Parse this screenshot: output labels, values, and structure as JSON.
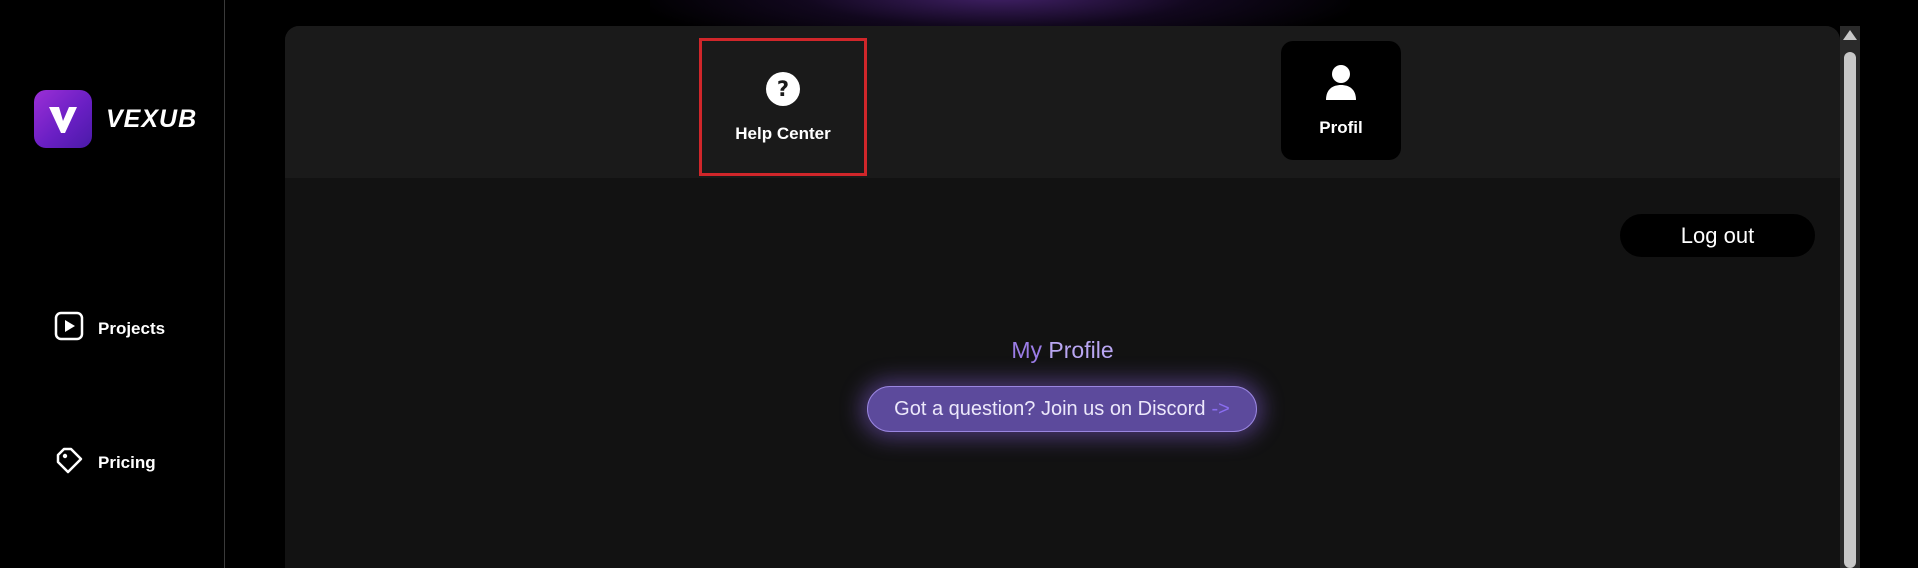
{
  "brand": {
    "name": "VEXUB",
    "color": "#8a2be2"
  },
  "sidebar": {
    "items": [
      {
        "label": "Projects",
        "icon": "play-square-icon"
      },
      {
        "label": "Pricing",
        "icon": "price-tag-icon"
      }
    ]
  },
  "topbar": {
    "tabs": [
      {
        "label": "Help Center",
        "icon": "question-circle-icon",
        "highlight_color": "#d0262a"
      },
      {
        "label": "Profil",
        "icon": "user-icon"
      }
    ]
  },
  "main": {
    "logout_label": "Log out",
    "title_part1": "My",
    "title_part2": " Profile",
    "discord_text": "Got a question? Join us on Discord",
    "discord_arrow": "->",
    "accent_color": "#9b7ce6"
  }
}
